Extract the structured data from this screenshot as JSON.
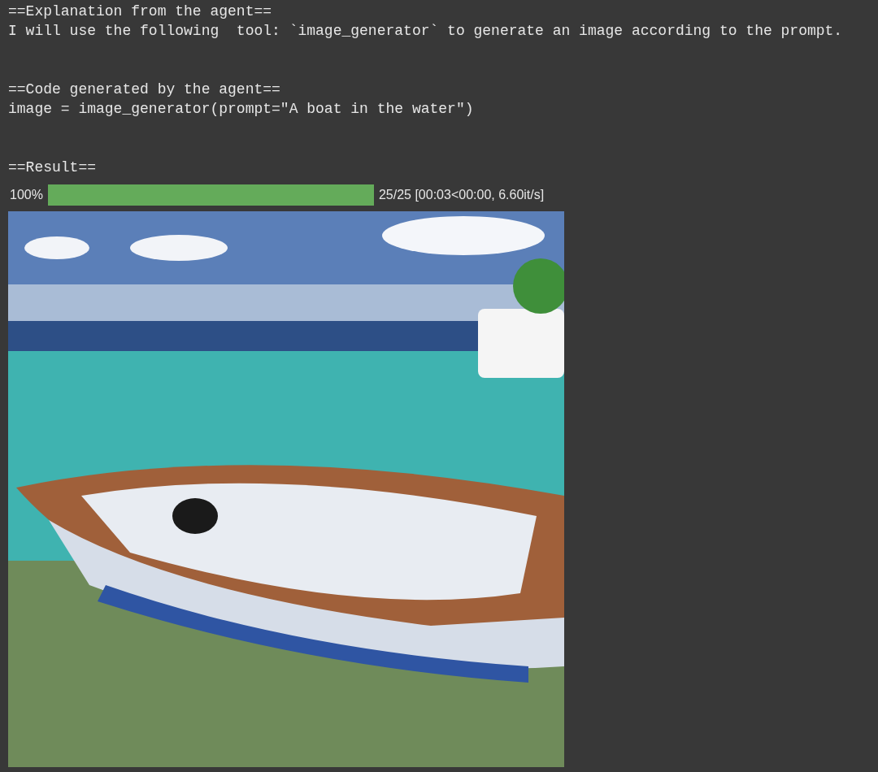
{
  "output_lines": [
    {
      "kind": "text",
      "text": "==Explanation from the agent=="
    },
    {
      "kind": "text",
      "text": "I will use the following  tool: `image_generator` to generate an image according to the prompt."
    },
    {
      "kind": "blank"
    },
    {
      "kind": "blank"
    },
    {
      "kind": "text",
      "text": "==Code generated by the agent=="
    },
    {
      "kind": "text",
      "text": "image = image_generator(prompt=\"A boat in the water\")"
    },
    {
      "kind": "blank"
    },
    {
      "kind": "blank"
    },
    {
      "kind": "text",
      "text": "==Result=="
    }
  ],
  "progress": {
    "percent": "100%",
    "level": 1,
    "status": "25/25 [00:03<00:00, 6.60it/s]"
  }
}
